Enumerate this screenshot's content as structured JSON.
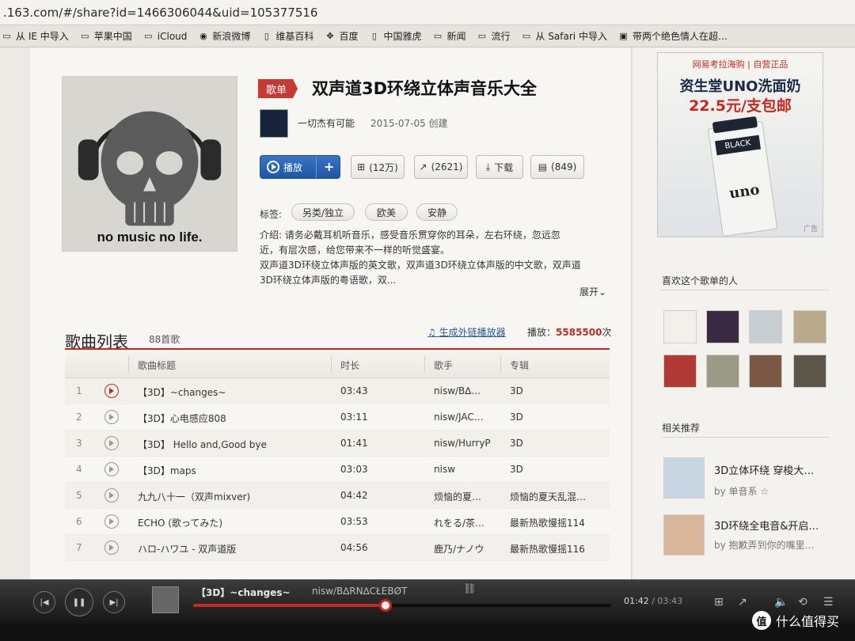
{
  "browser": {
    "url": ".163.com/#/share?id=1466306044&uid=105377516",
    "bookmarks": [
      {
        "label": "从 IE 中导入",
        "icon": "folder-icon"
      },
      {
        "label": "苹果中国",
        "icon": "apple-icon"
      },
      {
        "label": "iCloud",
        "icon": "apple-icon"
      },
      {
        "label": "新浪微博",
        "icon": "weibo-icon"
      },
      {
        "label": "维基百科",
        "icon": "page-icon"
      },
      {
        "label": "百度",
        "icon": "baidu-icon"
      },
      {
        "label": "中国雅虎",
        "icon": "page-icon"
      },
      {
        "label": "新闻",
        "icon": "folder-icon"
      },
      {
        "label": "流行",
        "icon": "folder-icon"
      },
      {
        "label": "从 Safari 中导入",
        "icon": "folder-icon"
      },
      {
        "label": "带两个绝色情人在超…",
        "icon": "site-icon"
      }
    ]
  },
  "playlist": {
    "badge": "歌单",
    "title": "双声道3D环绕立体声音乐大全",
    "cover_text": "no music no life.",
    "creator": "一切杰有可能",
    "created": "2015-07-05 创建",
    "buttons": {
      "play": "播放",
      "add": "+",
      "favorite": "(12万)",
      "share": "(2621)",
      "download": "下载",
      "comment": "(849)"
    },
    "tags_label": "标签:",
    "tags": [
      "另类/独立",
      "欧美",
      "安静"
    ],
    "description_lines": [
      "介绍:  请务必戴耳机听音乐，感受音乐贯穿你的耳朵，左右环绕，忽远忽",
      "近，有层次感，给您带来不一样的听觉盛宴。",
      "双声道3D环绕立体声版的英文歌，双声道3D环绕立体声版的中文歌，双声道",
      "3D环绕立体声版的粤语歌，双..."
    ],
    "expand": "展开"
  },
  "song_list": {
    "title": "歌曲列表",
    "count": "88首歌",
    "external_player": "生成外链播放器",
    "plays_label": "播放：",
    "plays_value": "5585500",
    "plays_unit": "次",
    "columns": [
      "歌曲标题",
      "时长",
      "歌手",
      "专辑"
    ],
    "rows": [
      {
        "num": "1",
        "title": "【3D】~changes~",
        "duration": "03:43",
        "artist": "nisw/B∆…",
        "album": "3D"
      },
      {
        "num": "2",
        "title": "【3D】心电感应808",
        "duration": "03:11",
        "artist": "nisw/JAC…",
        "album": "3D"
      },
      {
        "num": "3",
        "title": "【3D】 Hello and,Good bye",
        "duration": "01:41",
        "artist": "nisw/HurryP",
        "album": "3D"
      },
      {
        "num": "4",
        "title": "【3D】maps",
        "duration": "03:03",
        "artist": "nisw",
        "album": "3D"
      },
      {
        "num": "5",
        "title": "九九八十一（双声mixver)",
        "duration": "04:42",
        "artist": "烦恼的夏…",
        "album": "烦恼的夏天乱混…"
      },
      {
        "num": "6",
        "title": "ECHO (歌ってみた)",
        "duration": "03:53",
        "artist": "れをる/茶…",
        "album": "最新热歌慢摇114"
      },
      {
        "num": "7",
        "title": "ハロ-ハワユ - 双声道版",
        "duration": "04:56",
        "artist": "鹿乃/ナノウ",
        "album": "最新热歌慢摇116"
      }
    ]
  },
  "sidebar": {
    "ad": {
      "top": "网易考拉海购 | 自营正品",
      "line1": "资生堂UNO洗面奶",
      "line2": "22.5元/支包邮",
      "product_label1": "BLACK",
      "product_label2": "uno",
      "corner": "广告"
    },
    "fans_title": "喜欢这个歌单的人",
    "related_title": "相关推荐",
    "related": [
      {
        "title": "3D立体环绕 穿梭大…",
        "by": "by  单音系 ☆"
      },
      {
        "title": "3D环绕全电音&开启…",
        "by": "by  抱歉弄到你的嘴里…"
      }
    ]
  },
  "player": {
    "now_title": "【3D】~changes~",
    "now_artist": "nisw/B∆RN∆CŁEBØT",
    "current_time": "01:42",
    "total_time": "03:43",
    "progress": 0.46
  },
  "watermark": {
    "badge": "值",
    "text": "什么值得买"
  }
}
